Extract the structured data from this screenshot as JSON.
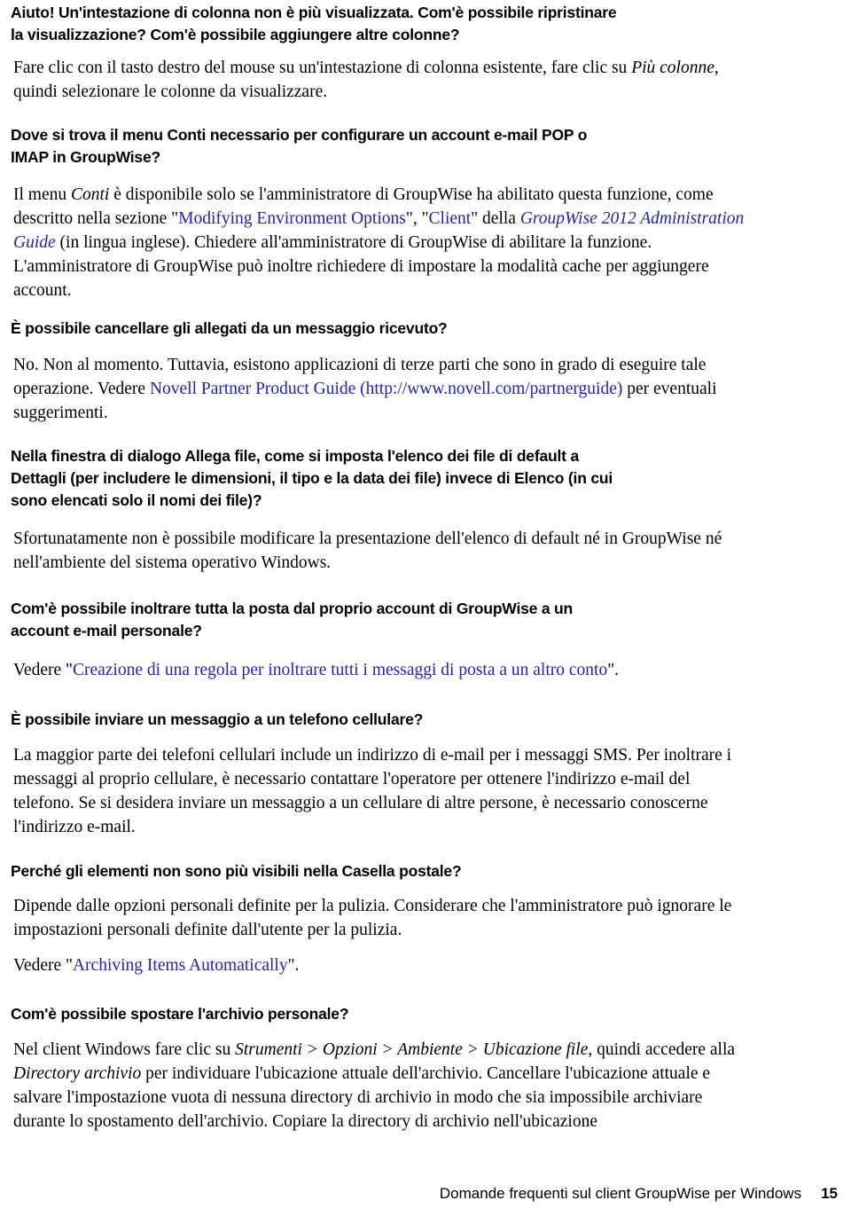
{
  "document": {
    "language": "it",
    "link_color": "#2222bb",
    "text_color": "#000000",
    "background_color": "#ffffff"
  },
  "faq": [
    {
      "heading_line1": "Aiuto! Un'intestazione di colonna non è più visualizzata. Com'è possibile ripristinare",
      "heading_line2": "la visualizzazione? Com'è possibile aggiungere altre colonne?",
      "answer": {
        "part1": "Fare clic con il tasto destro del mouse su un'intestazione di colonna esistente, fare clic su ",
        "italic1": "Più colonne",
        "part2": ", quindi selezionare le colonne da visualizzare."
      }
    },
    {
      "heading_line1": "Dove si trova il menu Conti necessario per configurare un account e-mail POP o",
      "heading_line2": "IMAP in GroupWise?",
      "answer": {
        "part1": "Il menu ",
        "italic1": "Conti",
        "part2": " è disponibile solo se l'amministratore di GroupWise ha abilitato questa funzione, come descritto nella sezione \"",
        "link1": "Modifying Environment Options",
        "part3": "\", \"",
        "link2": "Client",
        "part4": "\" della ",
        "link3": "GroupWise 2012 Administration Guide",
        "part5": " (in lingua inglese). Chiedere all'amministratore di GroupWise di abilitare la funzione. L'amministratore di GroupWise può inoltre richiedere di impostare la modalità cache per aggiungere account."
      }
    },
    {
      "heading_line1": "È possibile cancellare gli allegati da un messaggio ricevuto?",
      "heading_line2": "",
      "answer": {
        "part1": "No. Non al momento. Tuttavia, esistono applicazioni di terze parti che sono in grado di eseguire tale operazione. Vedere ",
        "link1": "Novell Partner Product Guide (http://www.novell.com/partnerguide)",
        "part2": " per eventuali suggerimenti."
      }
    },
    {
      "heading_line1": "Nella finestra di dialogo Allega file, come si imposta l'elenco dei file di default a",
      "heading_line2": "Dettagli (per includere le dimensioni, il tipo e la data dei file) invece di Elenco (in cui",
      "heading_line3": "sono elencati solo il nomi dei file)?",
      "answer": {
        "part1": "Sfortunatamente non è possibile modificare la presentazione dell'elenco di default né in GroupWise né nell'ambiente del sistema operativo Windows."
      }
    },
    {
      "heading_line1": "Com'è possibile inoltrare tutta la posta dal proprio account di GroupWise a un",
      "heading_line2": "account e-mail personale?",
      "answer": {
        "part1": "Vedere \"",
        "link1": "Creazione di una regola per inoltrare tutti i messaggi di posta a un altro conto",
        "part2": "\"."
      }
    },
    {
      "heading_line1": "È possibile inviare un messaggio a un telefono cellulare?",
      "heading_line2": "",
      "answer": {
        "part1": "La maggior parte dei telefoni cellulari include un indirizzo di e-mail per i messaggi SMS. Per inoltrare i messaggi al proprio cellulare, è necessario contattare l'operatore per ottenere l'indirizzo e-mail del telefono. Se si desidera inviare un messaggio a un cellulare di altre persone, è necessario conoscerne l'indirizzo e-mail."
      }
    },
    {
      "heading_line1": "Perché gli elementi non sono più visibili nella Casella postale?",
      "heading_line2": "",
      "answer": {
        "part1": "Dipende dalle opzioni personali definite per la pulizia. Considerare che l'amministratore può ignorare le impostazioni personali definite dall'utente per la pulizia."
      },
      "answer2": {
        "part1": "Vedere \"",
        "link1": "Archiving Items Automatically",
        "part2": "\"."
      }
    },
    {
      "heading_line1": "Com'è possibile spostare l'archivio personale?",
      "heading_line2": "",
      "answer": {
        "part1": "Nel client Windows fare clic su ",
        "italic1": "Strumenti",
        "sep1": " > ",
        "italic2": "Opzioni",
        "sep2": " > ",
        "italic3": "Ambiente",
        "sep3": " > ",
        "italic4": "Ubicazione file",
        "part2": ", quindi accedere alla ",
        "italic5": "Directory archivio",
        "part3": " per individuare l'ubicazione attuale dell'archivio. Cancellare l'ubicazione attuale e salvare l'impostazione vuota di nessuna directory di archivio in modo che sia impossibile archiviare durante lo spostamento dell'archivio. Copiare la directory di archivio nell'ubicazione"
      }
    }
  ],
  "footer": {
    "title": "Domande frequenti sul client GroupWise per Windows",
    "page_number": "15"
  }
}
